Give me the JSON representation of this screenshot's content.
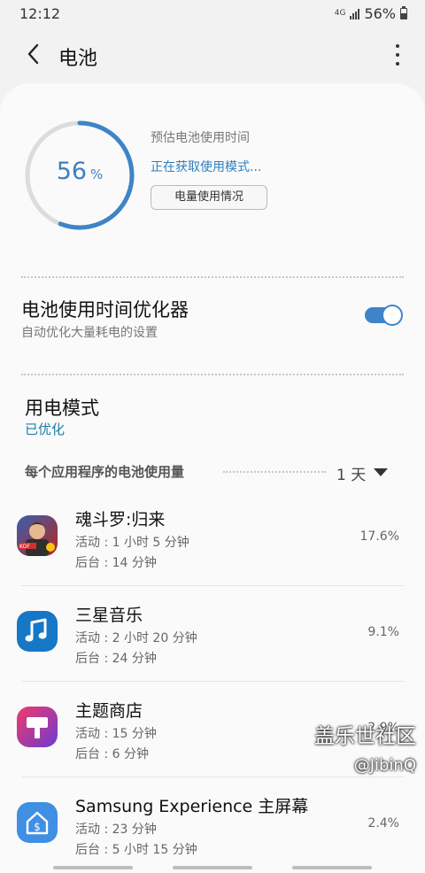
{
  "status_bar": {
    "time": "12:12",
    "network": "4G",
    "battery": "56%"
  },
  "app_bar": {
    "title": "电池"
  },
  "battery": {
    "level_percent": 56,
    "level_number": "56",
    "level_unit": "%",
    "estimate_label": "预估电池使用时间",
    "estimate_status": "正在获取使用模式...",
    "usage_button": "电量使用情况"
  },
  "optimizer": {
    "title": "电池使用时间优化器",
    "subtitle": "自动优化大量耗电的设置",
    "enabled": true
  },
  "power_mode": {
    "title": "用电模式",
    "value": "已优化"
  },
  "per_app": {
    "label": "每个应用程序的电池使用量",
    "period": "1 天",
    "apps": [
      {
        "name": "魂斗罗:归来",
        "active": "活动 : 1 小时 5 分钟",
        "background": "后台 : 14 分钟",
        "percent": "17.6%",
        "icon": "contra-game-icon"
      },
      {
        "name": "三星音乐",
        "active": "活动 : 2 小时 20 分钟",
        "background": "后台 : 24 分钟",
        "percent": "9.1%",
        "icon": "music-note-icon"
      },
      {
        "name": "主题商店",
        "active": "活动 : 15 分钟",
        "background": "后台 : 6 分钟",
        "percent": "2.9%",
        "icon": "paint-brush-icon"
      },
      {
        "name": "Samsung Experience 主屏幕",
        "active": "活动 : 23 分钟",
        "background": "后台 : 5 小时 15 分钟",
        "percent": "2.4%",
        "icon": "home-dollar-icon"
      }
    ]
  },
  "watermark": {
    "line1": "盖乐世社区",
    "line2": "@JibinQ"
  },
  "colors": {
    "accent": "#3e84c8",
    "link": "#2f7fbf",
    "mode_value": "#1f7aa8"
  }
}
